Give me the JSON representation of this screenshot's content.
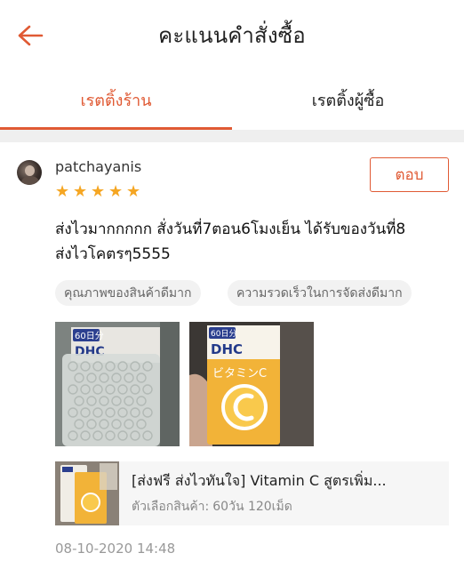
{
  "header": {
    "title": "คะแนนคำสั่งซื้อ",
    "back_icon": "arrow-left-icon"
  },
  "colors": {
    "accent": "#e05a34",
    "star": "#f5a623",
    "tag_bg": "#f2f2f2",
    "divider": "#efefef"
  },
  "tabs": [
    {
      "label": "เรตติ้งร้าน",
      "active": true
    },
    {
      "label": "เรตติ้งผู้ซื้อ",
      "active": false
    }
  ],
  "review": {
    "username": "patchayanis",
    "rating": 5,
    "reply_label": "ตอบ",
    "comment_line1": "ส่งไวมากกกกก สั่งวันที่7ตอน6โมงเย็น ได้รับของวันที่8",
    "comment_line2": "ส่งไวโคตรๆ5555",
    "tags": [
      "คุณภาพของสินค้าดีมาก",
      "ความรวดเร็วในการจัดส่งดีมาก"
    ],
    "product": {
      "title": "[ส่งฟรี ส่งไวทันใจ] Vitamin C สูตรเพิ่ม...",
      "variant_label": "ตัวเลือกสินค้า:",
      "variant_value": "60วัน 120เม็ด"
    },
    "timestamp": "08-10-2020 14:48",
    "photo_text": {
      "badge": "60日分",
      "brand": "DHC",
      "product_name": "ビタミンC"
    }
  }
}
